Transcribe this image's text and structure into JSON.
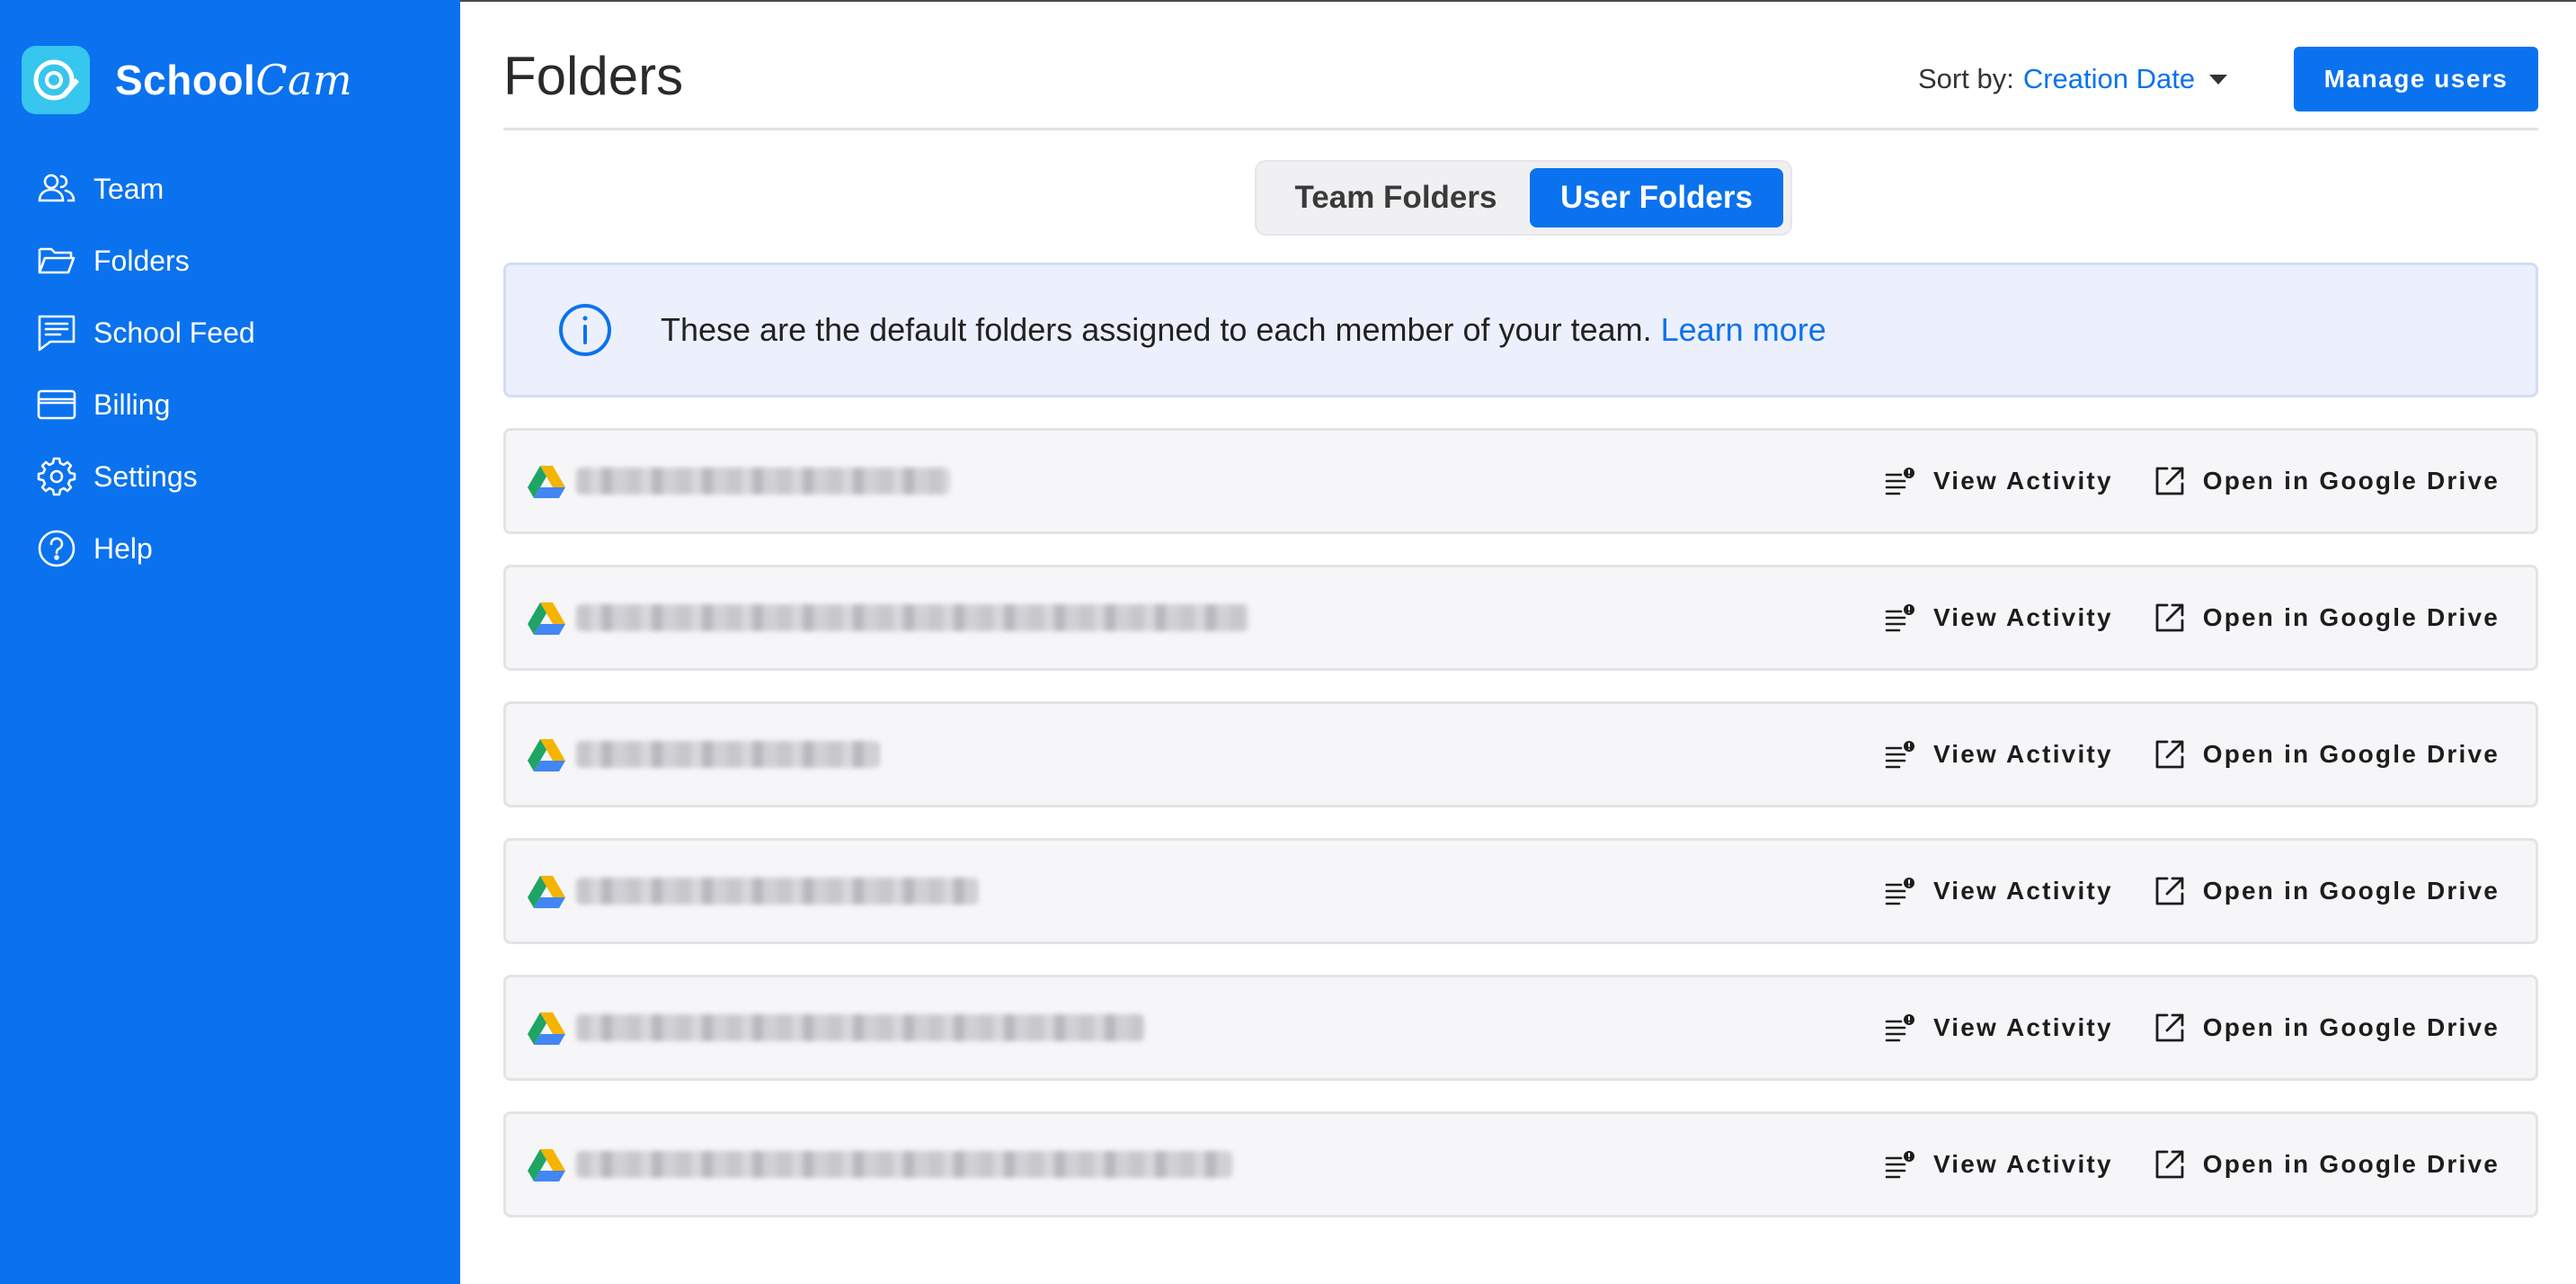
{
  "sidebar": {
    "brand": {
      "name_part1": "School",
      "name_part2": "Cam"
    },
    "items": [
      {
        "label": "Team",
        "icon": "team-icon"
      },
      {
        "label": "Folders",
        "icon": "folder-icon"
      },
      {
        "label": "School Feed",
        "icon": "feed-icon"
      },
      {
        "label": "Billing",
        "icon": "card-icon"
      },
      {
        "label": "Settings",
        "icon": "gear-icon"
      },
      {
        "label": "Help",
        "icon": "help-icon"
      }
    ]
  },
  "header": {
    "title": "Folders",
    "sort_label": "Sort by:",
    "sort_value": "Creation Date",
    "manage_users": "Manage users"
  },
  "tabs": {
    "team": "Team Folders",
    "user": "User Folders",
    "active": "user"
  },
  "info": {
    "text": "These are the default folders assigned to each member of your team.",
    "link": "Learn more"
  },
  "folders": {
    "view_activity": "View Activity",
    "open_drive": "Open in Google Drive",
    "rows": [
      {
        "redacted": true
      },
      {
        "redacted": true
      },
      {
        "redacted": true
      },
      {
        "redacted": true
      },
      {
        "redacted": true
      },
      {
        "redacted": true
      }
    ]
  },
  "colors": {
    "primary": "#0a72ee",
    "logo_bg": "#37c6ee",
    "info_bg": "#ecf0fc"
  }
}
